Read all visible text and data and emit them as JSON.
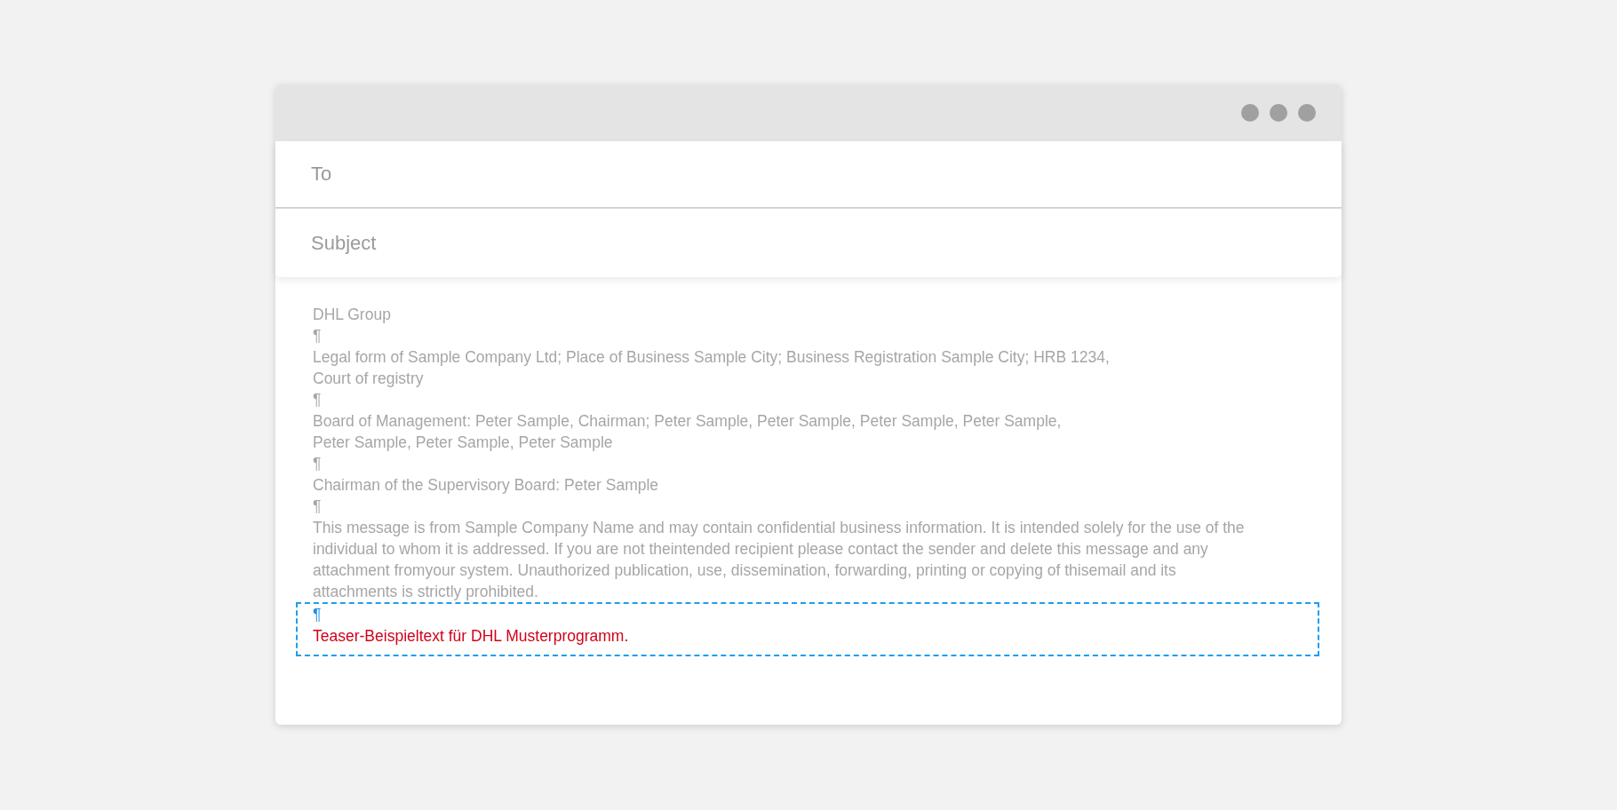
{
  "fields": [
    {
      "placeholder": "To"
    },
    {
      "placeholder": "Subject"
    }
  ],
  "body": {
    "lines": [
      "DHL Group",
      "¶",
      "Legal form of Sample Company Ltd; Place of Business Sample City; Business Registration Sample City; HRB 1234,",
      "Court of registry",
      "¶",
      "Board of Management: Peter Sample, Chairman; Peter Sample, Peter Sample, Peter Sample, Peter Sample,",
      "Peter Sample, Peter Sample, Peter Sample",
      "¶",
      "Chairman of the Supervisory Board: Peter Sample",
      "¶",
      "This message is from Sample Company Name and may contain confidential business information. It is intended solely for the use of the",
      "individual to whom it is addressed. If you are not theintended recipient please contact the sender and delete this message and any",
      "attachment fromyour system. Unauthorized publication, use, dissemination, forwarding, printing or copying of thisemail and its",
      "attachments is strictly prohibited."
    ],
    "highlight": [
      {
        "kind": "mark",
        "text": "¶"
      },
      {
        "kind": "teaser",
        "text": "Teaser-Beispieltext für DHL Musterprogramm."
      }
    ]
  }
}
